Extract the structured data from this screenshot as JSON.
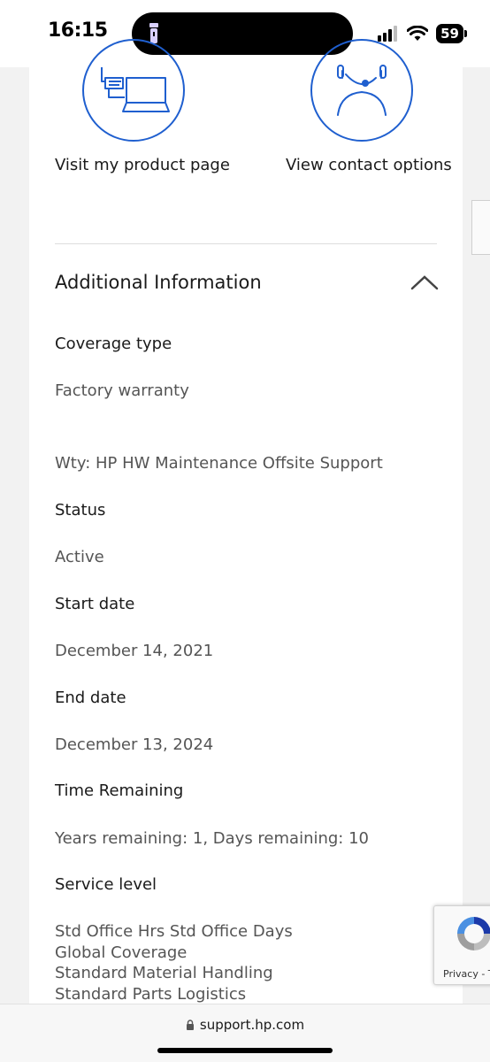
{
  "status_bar": {
    "time": "16:15",
    "battery": "59",
    "icons": [
      "flashlight-icon",
      "cellular-signal-icon",
      "wifi-icon",
      "battery-icon"
    ]
  },
  "actions": {
    "product_page": {
      "label": "Visit my product page",
      "icon": "laptop-icon"
    },
    "contact_options": {
      "label": "View contact options",
      "icon": "support-agent-icon"
    }
  },
  "section": {
    "title": "Additional Information",
    "icon": "chevron-up-icon"
  },
  "fields": {
    "coverage_type_label": "Coverage type",
    "coverage_type_value": "Factory warranty",
    "coverage_description": "Wty: HP HW Maintenance Offsite Support",
    "status_label": "Status",
    "status_value": "Active",
    "start_date_label": "Start date",
    "start_date_value": "December 14, 2021",
    "end_date_label": "End date",
    "end_date_value": "December 13, 2024",
    "time_remaining_label": "Time Remaining",
    "time_remaining_value": "Years remaining: 1, Days remaining: 10",
    "service_level_label": "Service level",
    "service_level_values": [
      "Std Office Hrs Std Office Days",
      "Global Coverage",
      "Standard Material Handling",
      "Standard Parts Logistics"
    ]
  },
  "recaptcha": {
    "text": "Privacy - T"
  },
  "browser": {
    "url": "support.hp.com"
  },
  "colors": {
    "accent": "#1f5fcf",
    "value_text": "#555555"
  }
}
